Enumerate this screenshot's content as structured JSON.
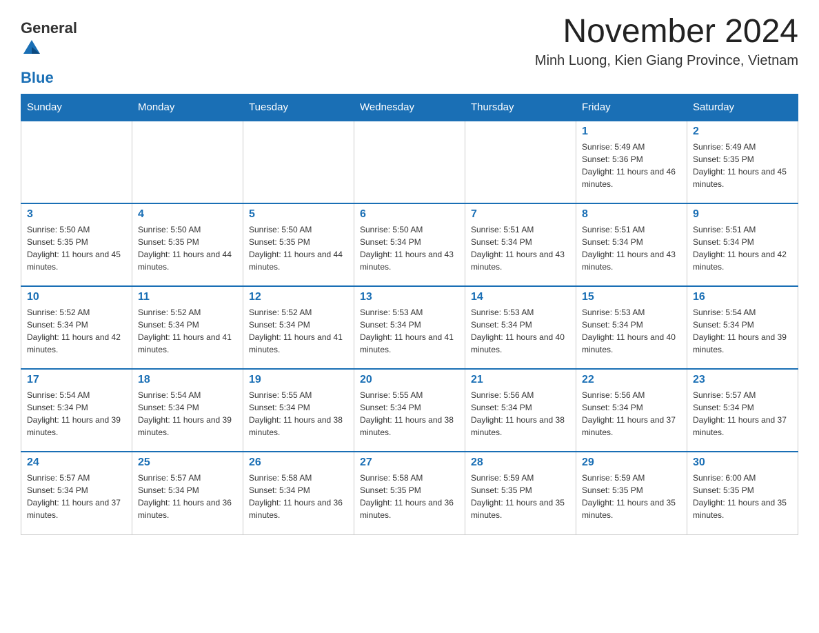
{
  "logo": {
    "general": "General",
    "blue": "Blue"
  },
  "title": "November 2024",
  "location": "Minh Luong, Kien Giang Province, Vietnam",
  "weekdays": [
    "Sunday",
    "Monday",
    "Tuesday",
    "Wednesday",
    "Thursday",
    "Friday",
    "Saturday"
  ],
  "weeks": [
    [
      {
        "day": "",
        "sunrise": "",
        "sunset": "",
        "daylight": ""
      },
      {
        "day": "",
        "sunrise": "",
        "sunset": "",
        "daylight": ""
      },
      {
        "day": "",
        "sunrise": "",
        "sunset": "",
        "daylight": ""
      },
      {
        "day": "",
        "sunrise": "",
        "sunset": "",
        "daylight": ""
      },
      {
        "day": "",
        "sunrise": "",
        "sunset": "",
        "daylight": ""
      },
      {
        "day": "1",
        "sunrise": "Sunrise: 5:49 AM",
        "sunset": "Sunset: 5:36 PM",
        "daylight": "Daylight: 11 hours and 46 minutes."
      },
      {
        "day": "2",
        "sunrise": "Sunrise: 5:49 AM",
        "sunset": "Sunset: 5:35 PM",
        "daylight": "Daylight: 11 hours and 45 minutes."
      }
    ],
    [
      {
        "day": "3",
        "sunrise": "Sunrise: 5:50 AM",
        "sunset": "Sunset: 5:35 PM",
        "daylight": "Daylight: 11 hours and 45 minutes."
      },
      {
        "day": "4",
        "sunrise": "Sunrise: 5:50 AM",
        "sunset": "Sunset: 5:35 PM",
        "daylight": "Daylight: 11 hours and 44 minutes."
      },
      {
        "day": "5",
        "sunrise": "Sunrise: 5:50 AM",
        "sunset": "Sunset: 5:35 PM",
        "daylight": "Daylight: 11 hours and 44 minutes."
      },
      {
        "day": "6",
        "sunrise": "Sunrise: 5:50 AM",
        "sunset": "Sunset: 5:34 PM",
        "daylight": "Daylight: 11 hours and 43 minutes."
      },
      {
        "day": "7",
        "sunrise": "Sunrise: 5:51 AM",
        "sunset": "Sunset: 5:34 PM",
        "daylight": "Daylight: 11 hours and 43 minutes."
      },
      {
        "day": "8",
        "sunrise": "Sunrise: 5:51 AM",
        "sunset": "Sunset: 5:34 PM",
        "daylight": "Daylight: 11 hours and 43 minutes."
      },
      {
        "day": "9",
        "sunrise": "Sunrise: 5:51 AM",
        "sunset": "Sunset: 5:34 PM",
        "daylight": "Daylight: 11 hours and 42 minutes."
      }
    ],
    [
      {
        "day": "10",
        "sunrise": "Sunrise: 5:52 AM",
        "sunset": "Sunset: 5:34 PM",
        "daylight": "Daylight: 11 hours and 42 minutes."
      },
      {
        "day": "11",
        "sunrise": "Sunrise: 5:52 AM",
        "sunset": "Sunset: 5:34 PM",
        "daylight": "Daylight: 11 hours and 41 minutes."
      },
      {
        "day": "12",
        "sunrise": "Sunrise: 5:52 AM",
        "sunset": "Sunset: 5:34 PM",
        "daylight": "Daylight: 11 hours and 41 minutes."
      },
      {
        "day": "13",
        "sunrise": "Sunrise: 5:53 AM",
        "sunset": "Sunset: 5:34 PM",
        "daylight": "Daylight: 11 hours and 41 minutes."
      },
      {
        "day": "14",
        "sunrise": "Sunrise: 5:53 AM",
        "sunset": "Sunset: 5:34 PM",
        "daylight": "Daylight: 11 hours and 40 minutes."
      },
      {
        "day": "15",
        "sunrise": "Sunrise: 5:53 AM",
        "sunset": "Sunset: 5:34 PM",
        "daylight": "Daylight: 11 hours and 40 minutes."
      },
      {
        "day": "16",
        "sunrise": "Sunrise: 5:54 AM",
        "sunset": "Sunset: 5:34 PM",
        "daylight": "Daylight: 11 hours and 39 minutes."
      }
    ],
    [
      {
        "day": "17",
        "sunrise": "Sunrise: 5:54 AM",
        "sunset": "Sunset: 5:34 PM",
        "daylight": "Daylight: 11 hours and 39 minutes."
      },
      {
        "day": "18",
        "sunrise": "Sunrise: 5:54 AM",
        "sunset": "Sunset: 5:34 PM",
        "daylight": "Daylight: 11 hours and 39 minutes."
      },
      {
        "day": "19",
        "sunrise": "Sunrise: 5:55 AM",
        "sunset": "Sunset: 5:34 PM",
        "daylight": "Daylight: 11 hours and 38 minutes."
      },
      {
        "day": "20",
        "sunrise": "Sunrise: 5:55 AM",
        "sunset": "Sunset: 5:34 PM",
        "daylight": "Daylight: 11 hours and 38 minutes."
      },
      {
        "day": "21",
        "sunrise": "Sunrise: 5:56 AM",
        "sunset": "Sunset: 5:34 PM",
        "daylight": "Daylight: 11 hours and 38 minutes."
      },
      {
        "day": "22",
        "sunrise": "Sunrise: 5:56 AM",
        "sunset": "Sunset: 5:34 PM",
        "daylight": "Daylight: 11 hours and 37 minutes."
      },
      {
        "day": "23",
        "sunrise": "Sunrise: 5:57 AM",
        "sunset": "Sunset: 5:34 PM",
        "daylight": "Daylight: 11 hours and 37 minutes."
      }
    ],
    [
      {
        "day": "24",
        "sunrise": "Sunrise: 5:57 AM",
        "sunset": "Sunset: 5:34 PM",
        "daylight": "Daylight: 11 hours and 37 minutes."
      },
      {
        "day": "25",
        "sunrise": "Sunrise: 5:57 AM",
        "sunset": "Sunset: 5:34 PM",
        "daylight": "Daylight: 11 hours and 36 minutes."
      },
      {
        "day": "26",
        "sunrise": "Sunrise: 5:58 AM",
        "sunset": "Sunset: 5:34 PM",
        "daylight": "Daylight: 11 hours and 36 minutes."
      },
      {
        "day": "27",
        "sunrise": "Sunrise: 5:58 AM",
        "sunset": "Sunset: 5:35 PM",
        "daylight": "Daylight: 11 hours and 36 minutes."
      },
      {
        "day": "28",
        "sunrise": "Sunrise: 5:59 AM",
        "sunset": "Sunset: 5:35 PM",
        "daylight": "Daylight: 11 hours and 35 minutes."
      },
      {
        "day": "29",
        "sunrise": "Sunrise: 5:59 AM",
        "sunset": "Sunset: 5:35 PM",
        "daylight": "Daylight: 11 hours and 35 minutes."
      },
      {
        "day": "30",
        "sunrise": "Sunrise: 6:00 AM",
        "sunset": "Sunset: 5:35 PM",
        "daylight": "Daylight: 11 hours and 35 minutes."
      }
    ]
  ]
}
